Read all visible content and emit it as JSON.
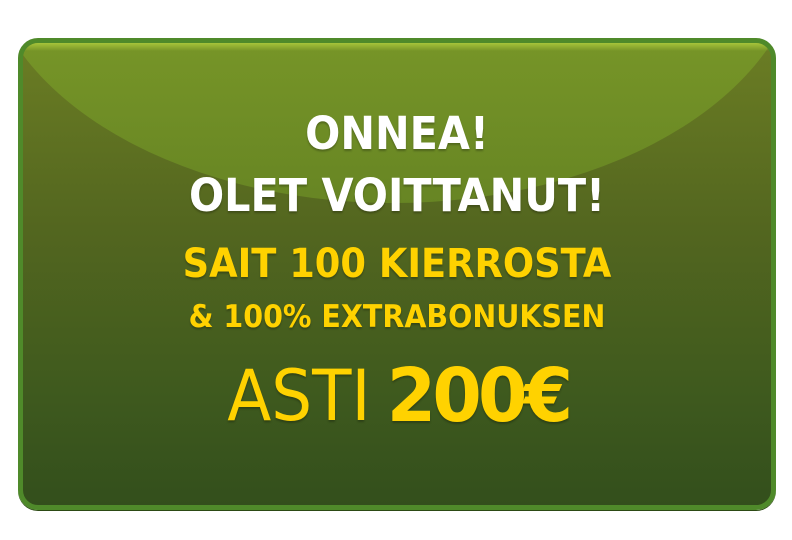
{
  "banner": {
    "line1": "ONNEA!",
    "line2": "OLET VOITTANUT!",
    "line3": "SAIT 100 KIERROSTA",
    "line4": "& 100% EXTRABONUKSEN",
    "line5_prefix": "ASTI",
    "line5_amount": "200€"
  },
  "colors": {
    "heading": "#ffffff",
    "offer": "#ffd200",
    "border": "#4f8a2a",
    "background_top": "#6b7d24",
    "background_bottom": "#334f1c"
  }
}
